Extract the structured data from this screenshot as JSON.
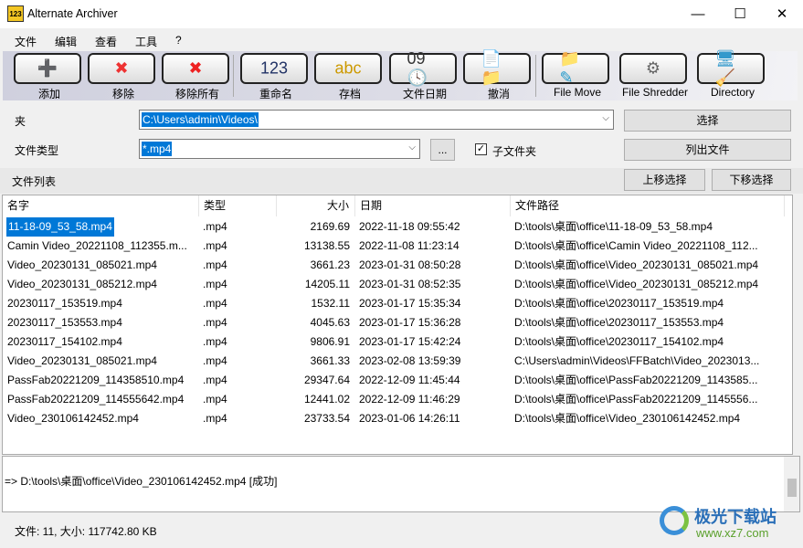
{
  "window": {
    "title": "Alternate Archiver",
    "icon": "123-icon"
  },
  "menu": [
    "文件",
    "编辑",
    "查看",
    "工具",
    "?"
  ],
  "toolbar": [
    {
      "label": "添加",
      "icon": "add-files-icon",
      "glyph": "➕",
      "color": "#3a3"
    },
    {
      "label": "移除",
      "icon": "remove-files-icon",
      "glyph": "✖",
      "color": "#e33"
    },
    {
      "label": "移除所有",
      "icon": "remove-all-icon",
      "glyph": "✖",
      "color": "#e22"
    },
    {
      "label": "重命名",
      "icon": "rename-123-icon",
      "glyph": "123",
      "color": "#236"
    },
    {
      "label": "存档",
      "icon": "archive-abc-icon",
      "glyph": "abc",
      "color": "#c90"
    },
    {
      "label": "文件日期",
      "icon": "calendar-clock-icon",
      "glyph": "09 🕓",
      "color": "#333"
    },
    {
      "label": "撤消",
      "icon": "undo-icon",
      "glyph": "📄📁",
      "color": "#c90"
    },
    {
      "label": "File Move",
      "icon": "file-move-icon",
      "glyph": "📁✎",
      "color": "#29c"
    },
    {
      "label": "File Shredder",
      "icon": "file-shredder-icon",
      "glyph": "⚙",
      "color": "#666"
    },
    {
      "label": "Directory",
      "icon": "directory-clean-icon",
      "glyph": "🖥🧹",
      "color": "#39c"
    }
  ],
  "form": {
    "folder_label": "夹",
    "folder_value": "C:\\Users\\admin\\Videos\\",
    "select_btn": "选择",
    "type_label": "文件类型",
    "type_value": "*.mp4",
    "browse_btn": "...",
    "subfolder_label": "子文件夹",
    "subfolder_checked": true,
    "list_btn": "列出文件",
    "list_label": "文件列表",
    "up_btn": "上移选择",
    "down_btn": "下移选择"
  },
  "columns": [
    "名字",
    "类型",
    "大小",
    "日期",
    "文件路径"
  ],
  "rows": [
    [
      "11-18-09_53_58.mp4",
      ".mp4",
      "2169.69",
      "2022-11-18 09:55:42",
      "D:\\tools\\桌面\\office\\11-18-09_53_58.mp4"
    ],
    [
      "Camin Video_20221108_112355.m...",
      ".mp4",
      "13138.55",
      "2022-11-08 11:23:14",
      "D:\\tools\\桌面\\office\\Camin Video_20221108_112..."
    ],
    [
      "Video_20230131_085021.mp4",
      ".mp4",
      "3661.23",
      "2023-01-31 08:50:28",
      "D:\\tools\\桌面\\office\\Video_20230131_085021.mp4"
    ],
    [
      "Video_20230131_085212.mp4",
      ".mp4",
      "14205.11",
      "2023-01-31 08:52:35",
      "D:\\tools\\桌面\\office\\Video_20230131_085212.mp4"
    ],
    [
      "20230117_153519.mp4",
      ".mp4",
      "1532.11",
      "2023-01-17 15:35:34",
      "D:\\tools\\桌面\\office\\20230117_153519.mp4"
    ],
    [
      "20230117_153553.mp4",
      ".mp4",
      "4045.63",
      "2023-01-17 15:36:28",
      "D:\\tools\\桌面\\office\\20230117_153553.mp4"
    ],
    [
      "20230117_154102.mp4",
      ".mp4",
      "9806.91",
      "2023-01-17 15:42:24",
      "D:\\tools\\桌面\\office\\20230117_154102.mp4"
    ],
    [
      "Video_20230131_085021.mp4",
      ".mp4",
      "3661.33",
      "2023-02-08 13:59:39",
      "C:\\Users\\admin\\Videos\\FFBatch\\Video_2023013..."
    ],
    [
      "PassFab20221209_114358510.mp4",
      ".mp4",
      "29347.64",
      "2022-12-09 11:45:44",
      "D:\\tools\\桌面\\office\\PassFab20221209_1143585..."
    ],
    [
      "PassFab20221209_114555642.mp4",
      ".mp4",
      "12441.02",
      "2022-12-09 11:46:29",
      "D:\\tools\\桌面\\office\\PassFab20221209_1145556..."
    ],
    [
      "Video_230106142452.mp4",
      ".mp4",
      "23733.54",
      "2023-01-06 14:26:11",
      "D:\\tools\\桌面\\office\\Video_230106142452.mp4"
    ]
  ],
  "selected_row": 0,
  "log": [
    "=> D:\\tools\\桌面\\office\\Video_230106142452.mp4 [成功]"
  ],
  "status": "文件: 11, 大小: 117742.80 KB",
  "watermark": {
    "text": "极光下载站",
    "url": "www.xz7.com"
  },
  "colors": {
    "selection": "#0078d7"
  }
}
